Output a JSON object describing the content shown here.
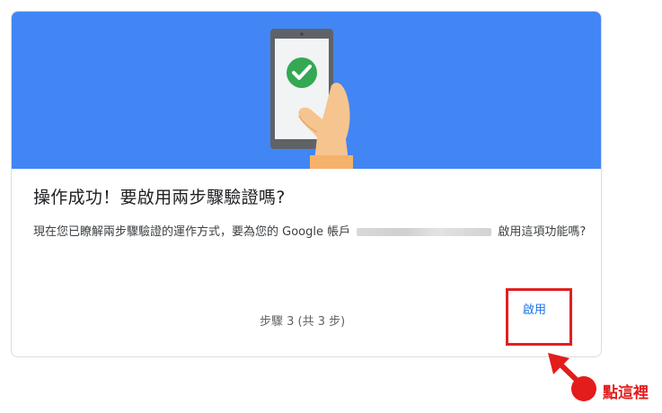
{
  "dialog": {
    "title": "操作成功！要啟用兩步驟驗證嗎?",
    "description_before": "現在您已瞭解兩步驟驗證的運作方式，要為您的 Google 帳戶",
    "description_after": "啟用這項功能嗎?",
    "step_text": "步驟 3 (共 3 步)",
    "enable_label": "啟用"
  },
  "hero": {
    "background_color": "#4285f4",
    "icon": "phone-check-icon"
  },
  "annotation": {
    "text": "點這裡",
    "color": "#e31c1c"
  }
}
